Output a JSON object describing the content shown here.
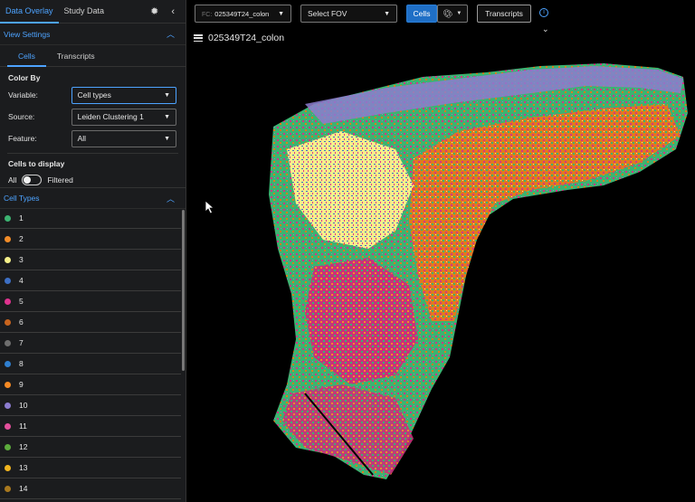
{
  "sidebar": {
    "tabs": [
      {
        "label": "Data Overlay",
        "active": true
      },
      {
        "label": "Study Data",
        "active": false
      }
    ],
    "icons": [
      "sun-icon",
      "chevron-left-icon"
    ],
    "view_settings": {
      "title": "View Settings",
      "subtabs": [
        {
          "label": "Cells",
          "active": true
        },
        {
          "label": "Transcripts",
          "active": false
        }
      ],
      "color_by": {
        "title": "Color By",
        "variable_label": "Variable:",
        "variable_value": "Cell types",
        "source_label": "Source:",
        "source_value": "Leiden Clustering 1",
        "feature_label": "Feature:",
        "feature_value": "All"
      },
      "cells_to_display": {
        "title": "Cells to display",
        "left_label": "All",
        "right_label": "Filtered"
      }
    },
    "cell_types": {
      "title": "Cell Types",
      "items": [
        {
          "label": "1",
          "color": "#3cb371"
        },
        {
          "label": "2",
          "color": "#f28c28"
        },
        {
          "label": "3",
          "color": "#f5f08a"
        },
        {
          "label": "4",
          "color": "#3d6fc4"
        },
        {
          "label": "5",
          "color": "#e0338f"
        },
        {
          "label": "6",
          "color": "#c8641e"
        },
        {
          "label": "7",
          "color": "#6e6e6e"
        },
        {
          "label": "8",
          "color": "#2f7fd0"
        },
        {
          "label": "9",
          "color": "#f58a24"
        },
        {
          "label": "10",
          "color": "#8c7ccf"
        },
        {
          "label": "11",
          "color": "#e34f9b"
        },
        {
          "label": "12",
          "color": "#5cab3c"
        },
        {
          "label": "13",
          "color": "#f0b41e"
        },
        {
          "label": "14",
          "color": "#a8781e"
        }
      ]
    }
  },
  "toolbar": {
    "slide_prefix": "FC:",
    "slide_value": "025349T24_colon",
    "fov_placeholder": "Select FOV",
    "cells_label": "Cells",
    "transcripts_label": "Transcripts"
  },
  "viewer": {
    "title": "025349T24_colon"
  }
}
